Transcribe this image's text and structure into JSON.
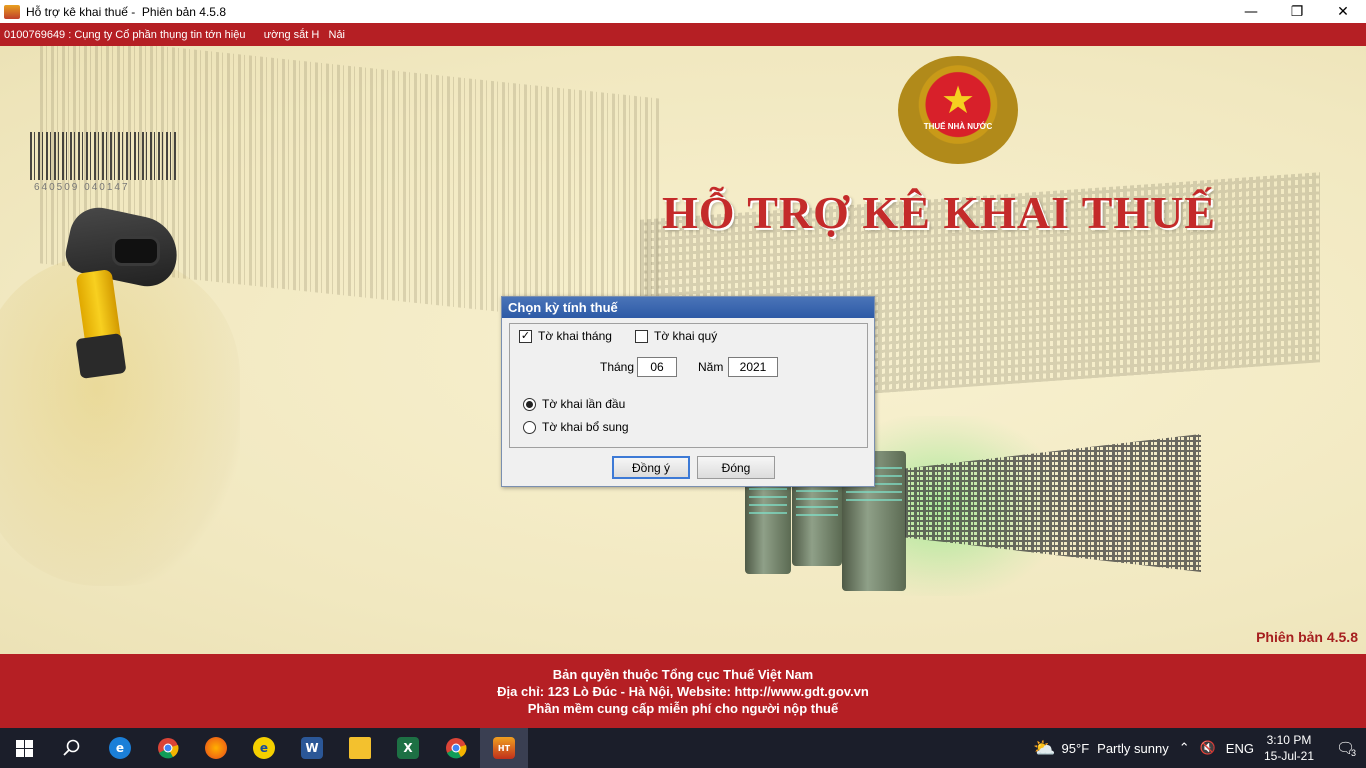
{
  "window": {
    "title": "Hỗ trợ kê khai thuế -  Phiên bản 4.5.8",
    "minimize": "—",
    "restore": "❐",
    "close": "✕"
  },
  "company_bar": {
    "text": "0100769649 : Cụng ty Cổ phần thụng tin tớn hiệu      ường sắt H   Nải"
  },
  "banner": {
    "barcode_number": "640509  040147",
    "emblem_text": "THUẾ NHÀ NƯỚC",
    "emblem_star": "★",
    "title": "HỖ TRỢ KÊ KHAI THUẾ",
    "version": "Phiên bản 4.5.8"
  },
  "dialog": {
    "title": "Chọn kỳ tính thuế",
    "monthly_checkbox": {
      "label": "Tờ khai tháng",
      "checked": true,
      "mark": "✓"
    },
    "quarterly_checkbox": {
      "label": "Tờ khai quý",
      "checked": false
    },
    "month_label": "Tháng",
    "month_value": "06",
    "year_label": "Năm",
    "year_value": "2021",
    "first_radio": {
      "label": "Tờ khai lần đầu",
      "selected": true
    },
    "supplement_radio": {
      "label": "Tờ khai bổ sung",
      "selected": false
    },
    "ok_button": "Đồng ý",
    "close_button": "Đóng"
  },
  "footer": {
    "line1": "Bản quyền thuộc Tổng cục Thuế Việt Nam",
    "line2": "Địa chỉ: 123 Lò Đúc - Hà Nội, Website: http://www.gdt.gov.vn",
    "line3": "Phần mềm cung cấp miễn phí cho người nộp thuế"
  },
  "taskbar": {
    "weather_temp": "95°F",
    "weather_desc": "Partly sunny",
    "language": "ENG",
    "time": "3:10 PM",
    "date": "15-Jul-21",
    "notification_count": "3",
    "colors": {
      "bg": "#1b1e2a",
      "accent_red": "#b51f24"
    }
  }
}
